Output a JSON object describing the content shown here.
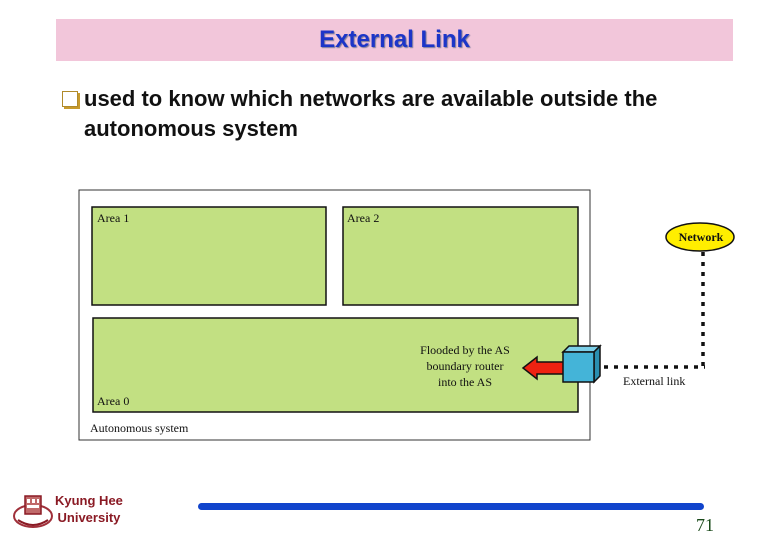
{
  "slide": {
    "title": "External Link",
    "bullet": {
      "icon": "square-bullet-icon",
      "line1": "used to know which networks are available outside the",
      "line2": "autonomous system"
    },
    "page_number": "71"
  },
  "diagram": {
    "autonomous_system_label": "Autonomous system",
    "areas": [
      {
        "label": "Area 1"
      },
      {
        "label": "Area 2"
      },
      {
        "label": "Area 0"
      }
    ],
    "flood_note": [
      "Flooded by the AS",
      "boundary router",
      "into the AS"
    ],
    "external_link_label": "External link",
    "network_label": "Network",
    "colors": {
      "area_fill": "#c2e082",
      "router_fill": "#44b4d8",
      "arrow_fill": "#ee2211",
      "network_fill": "#ffee00"
    }
  },
  "footer": {
    "university_line1": "Kyung Hee",
    "university_line2": "University"
  }
}
